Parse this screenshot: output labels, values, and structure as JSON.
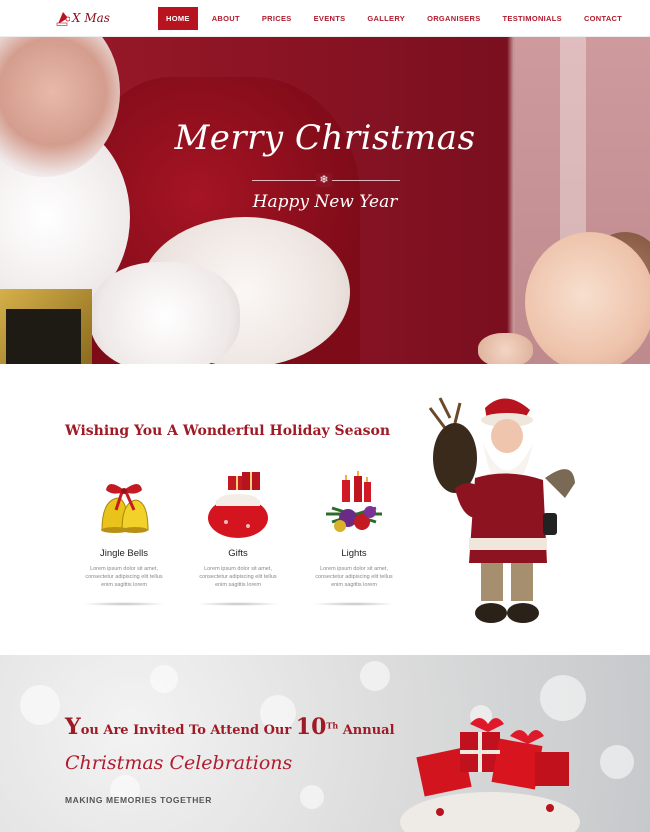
{
  "brand": {
    "logo_text": "X Mas"
  },
  "nav": {
    "items": [
      {
        "label": "HOME",
        "active": true
      },
      {
        "label": "ABOUT",
        "active": false
      },
      {
        "label": "PRICES",
        "active": false
      },
      {
        "label": "EVENTS",
        "active": false
      },
      {
        "label": "GALLERY",
        "active": false
      },
      {
        "label": "ORGANISERS",
        "active": false
      },
      {
        "label": "TESTIMONIALS",
        "active": false
      },
      {
        "label": "CONTACT",
        "active": false
      }
    ]
  },
  "hero": {
    "title": "Merry Christmas",
    "divider_icon": "snowflake-icon",
    "subtitle": "Happy New Year"
  },
  "wishes": {
    "title": "Wishing You A Wonderful Holiday Season",
    "cards": [
      {
        "icon": "jingle-bells-icon",
        "title": "Jingle Bells",
        "text": "Lorem ipsum dolor sit amet, consectetur adipiscing elit tellus enim sagittis lorem"
      },
      {
        "icon": "gifts-icon",
        "title": "Gifts",
        "text": "Lorem ipsum dolor sit amet, consectetur adipiscing elit tellus enim sagittis lorem"
      },
      {
        "icon": "lights-icon",
        "title": "Lights",
        "text": "Lorem ipsum dolor sit amet, consectetur adipiscing elit tellus enim sagittis lorem"
      }
    ]
  },
  "invite": {
    "title_part1": "ou Are Invited To Attend Our ",
    "title_cap": "Y",
    "title_num": "10",
    "title_sup": "Th",
    "title_part2": " Annual",
    "subtitle": "Christmas Celebrations",
    "tagline": "MAKING MEMORIES TOGETHER"
  },
  "colors": {
    "brand_red": "#b8141f",
    "heading_red": "#a01a25"
  }
}
